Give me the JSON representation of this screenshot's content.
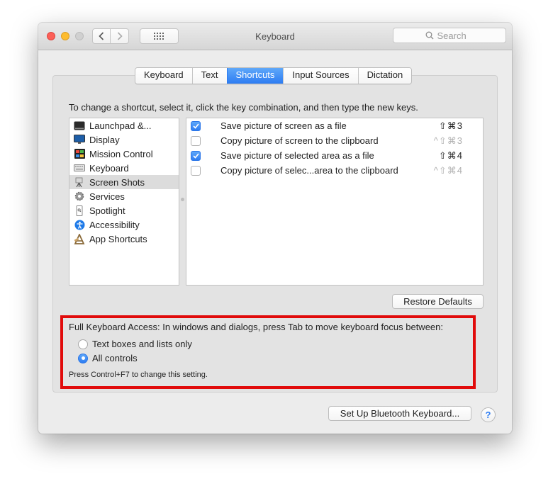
{
  "window": {
    "title": "Keyboard"
  },
  "search": {
    "placeholder": "Search"
  },
  "tabs": [
    {
      "label": "Keyboard",
      "active": false
    },
    {
      "label": "Text",
      "active": false
    },
    {
      "label": "Shortcuts",
      "active": true
    },
    {
      "label": "Input Sources",
      "active": false
    },
    {
      "label": "Dictation",
      "active": false
    }
  ],
  "shortcuts": {
    "instructions": "To change a shortcut, select it, click the key combination, and then type the new keys.",
    "categories": [
      {
        "label": "Launchpad &...",
        "icon": "launchpad-icon"
      },
      {
        "label": "Display",
        "icon": "display-icon"
      },
      {
        "label": "Mission Control",
        "icon": "mission-control-icon"
      },
      {
        "label": "Keyboard",
        "icon": "keyboard-icon"
      },
      {
        "label": "Screen Shots",
        "icon": "screenshot-icon",
        "selected": true
      },
      {
        "label": "Services",
        "icon": "gear-icon"
      },
      {
        "label": "Spotlight",
        "icon": "spotlight-icon"
      },
      {
        "label": "Accessibility",
        "icon": "accessibility-icon"
      },
      {
        "label": "App Shortcuts",
        "icon": "app-shortcuts-icon"
      }
    ],
    "items": [
      {
        "label": "Save picture of screen as a file",
        "keys": "⇧⌘3",
        "checked": true
      },
      {
        "label": "Copy picture of screen to the clipboard",
        "keys": "^⇧⌘3",
        "checked": false
      },
      {
        "label": "Save picture of selected area as a file",
        "keys": "⇧⌘4",
        "checked": true
      },
      {
        "label": "Copy picture of selec...area to the clipboard",
        "keys": "^⇧⌘4",
        "checked": false
      }
    ],
    "restore_label": "Restore Defaults"
  },
  "full_keyboard_access": {
    "title": "Full Keyboard Access: In windows and dialogs, press Tab to move keyboard focus between:",
    "options": [
      {
        "label": "Text boxes and lists only",
        "selected": false
      },
      {
        "label": "All controls",
        "selected": true
      }
    ],
    "note": "Press Control+F7 to change this setting."
  },
  "footer": {
    "bluetooth_label": "Set Up Bluetooth Keyboard...",
    "help_label": "?"
  },
  "colors": {
    "accent": "#2d7cf2",
    "highlight_border": "#e10b0b"
  }
}
